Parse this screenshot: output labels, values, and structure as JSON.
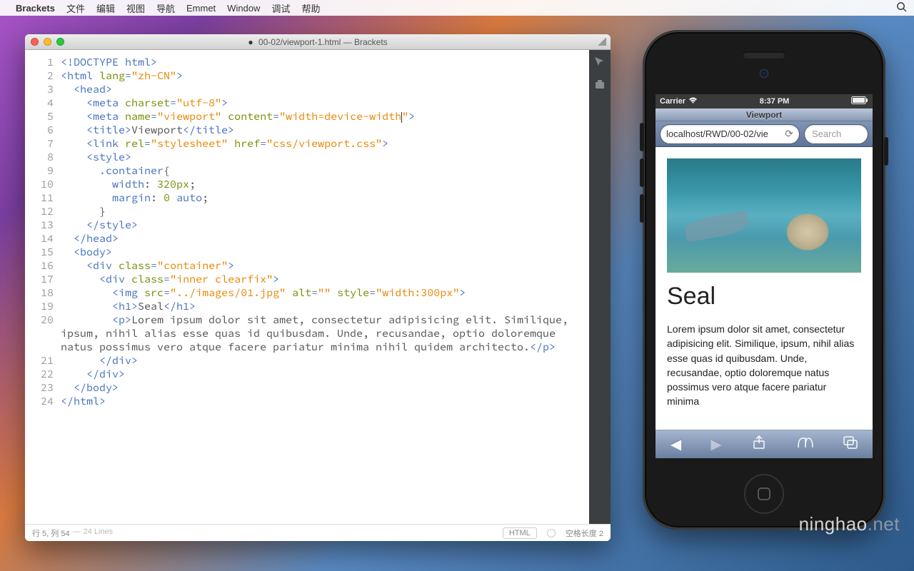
{
  "menubar": {
    "appname": "Brackets",
    "items": [
      "文件",
      "编辑",
      "视图",
      "导航",
      "Emmet",
      "Window",
      "调试",
      "帮助"
    ]
  },
  "window": {
    "title_prefix": "00-02/viewport-1.html",
    "title_suffix": "Brackets"
  },
  "code_lines": [
    [
      {
        "t": "tag",
        "v": "<!DOCTYPE html>"
      }
    ],
    [
      {
        "t": "tag",
        "v": "<html "
      },
      {
        "t": "attr",
        "v": "lang"
      },
      {
        "t": "tag",
        "v": "="
      },
      {
        "t": "str",
        "v": "\"zh-CN\""
      },
      {
        "t": "tag",
        "v": ">"
      }
    ],
    [
      {
        "t": "plain",
        "v": "  "
      },
      {
        "t": "tag",
        "v": "<head>"
      }
    ],
    [
      {
        "t": "plain",
        "v": "    "
      },
      {
        "t": "tag",
        "v": "<meta "
      },
      {
        "t": "attr",
        "v": "charset"
      },
      {
        "t": "tag",
        "v": "="
      },
      {
        "t": "str",
        "v": "\"utf-8\""
      },
      {
        "t": "tag",
        "v": ">"
      }
    ],
    [
      {
        "t": "plain",
        "v": "    "
      },
      {
        "t": "tag",
        "v": "<meta "
      },
      {
        "t": "attr",
        "v": "name"
      },
      {
        "t": "tag",
        "v": "="
      },
      {
        "t": "str",
        "v": "\"viewport\""
      },
      {
        "t": "plain",
        "v": " "
      },
      {
        "t": "attr",
        "v": "content"
      },
      {
        "t": "tag",
        "v": "="
      },
      {
        "t": "str",
        "v": "\"width=device-width"
      },
      {
        "t": "caret",
        "v": ""
      },
      {
        "t": "str",
        "v": "\""
      },
      {
        "t": "tag",
        "v": ">"
      }
    ],
    [
      {
        "t": "plain",
        "v": "    "
      },
      {
        "t": "tag",
        "v": "<title>"
      },
      {
        "t": "plain",
        "v": "Viewport"
      },
      {
        "t": "tag",
        "v": "</title>"
      }
    ],
    [
      {
        "t": "plain",
        "v": "    "
      },
      {
        "t": "tag",
        "v": "<link "
      },
      {
        "t": "attr",
        "v": "rel"
      },
      {
        "t": "tag",
        "v": "="
      },
      {
        "t": "str",
        "v": "\"stylesheet\""
      },
      {
        "t": "plain",
        "v": " "
      },
      {
        "t": "attr",
        "v": "href"
      },
      {
        "t": "tag",
        "v": "="
      },
      {
        "t": "str",
        "v": "\"css/viewport.css\""
      },
      {
        "t": "tag",
        "v": ">"
      }
    ],
    [
      {
        "t": "plain",
        "v": "    "
      },
      {
        "t": "tag",
        "v": "<style>"
      }
    ],
    [
      {
        "t": "plain",
        "v": "      "
      },
      {
        "t": "kw",
        "v": ".container"
      },
      {
        "t": "plain",
        "v": "{"
      }
    ],
    [
      {
        "t": "plain",
        "v": "        "
      },
      {
        "t": "kw",
        "v": "width"
      },
      {
        "t": "plain",
        "v": ": "
      },
      {
        "t": "num-lit",
        "v": "320px"
      },
      {
        "t": "plain",
        "v": ";"
      }
    ],
    [
      {
        "t": "plain",
        "v": "        "
      },
      {
        "t": "kw",
        "v": "margin"
      },
      {
        "t": "plain",
        "v": ": "
      },
      {
        "t": "num-lit",
        "v": "0"
      },
      {
        "t": "plain",
        "v": " "
      },
      {
        "t": "kw",
        "v": "auto"
      },
      {
        "t": "plain",
        "v": ";"
      }
    ],
    [
      {
        "t": "plain",
        "v": "      }"
      }
    ],
    [
      {
        "t": "plain",
        "v": "    "
      },
      {
        "t": "tag",
        "v": "</style>"
      }
    ],
    [
      {
        "t": "plain",
        "v": "  "
      },
      {
        "t": "tag",
        "v": "</head>"
      }
    ],
    [
      {
        "t": "plain",
        "v": "  "
      },
      {
        "t": "tag",
        "v": "<body>"
      }
    ],
    [
      {
        "t": "plain",
        "v": "    "
      },
      {
        "t": "tag",
        "v": "<div "
      },
      {
        "t": "attr",
        "v": "class"
      },
      {
        "t": "tag",
        "v": "="
      },
      {
        "t": "str",
        "v": "\"container\""
      },
      {
        "t": "tag",
        "v": ">"
      }
    ],
    [
      {
        "t": "plain",
        "v": "      "
      },
      {
        "t": "tag",
        "v": "<div "
      },
      {
        "t": "attr",
        "v": "class"
      },
      {
        "t": "tag",
        "v": "="
      },
      {
        "t": "str",
        "v": "\"inner clearfix\""
      },
      {
        "t": "tag",
        "v": ">"
      }
    ],
    [
      {
        "t": "plain",
        "v": "        "
      },
      {
        "t": "tag",
        "v": "<img "
      },
      {
        "t": "attr",
        "v": "src"
      },
      {
        "t": "tag",
        "v": "="
      },
      {
        "t": "str",
        "v": "\"../images/01.jpg\""
      },
      {
        "t": "plain",
        "v": " "
      },
      {
        "t": "attr",
        "v": "alt"
      },
      {
        "t": "tag",
        "v": "="
      },
      {
        "t": "str",
        "v": "\"\""
      },
      {
        "t": "plain",
        "v": " "
      },
      {
        "t": "attr",
        "v": "style"
      },
      {
        "t": "tag",
        "v": "="
      },
      {
        "t": "str",
        "v": "\"width:300px\""
      },
      {
        "t": "tag",
        "v": ">"
      }
    ],
    [
      {
        "t": "plain",
        "v": "        "
      },
      {
        "t": "tag",
        "v": "<h1>"
      },
      {
        "t": "plain",
        "v": "Seal"
      },
      {
        "t": "tag",
        "v": "</h1>"
      }
    ],
    [
      {
        "t": "plain",
        "v": "        "
      },
      {
        "t": "tag",
        "v": "<p>"
      },
      {
        "t": "plain",
        "v": "Lorem ipsum dolor sit amet, consectetur adipisicing elit. Similique, \nipsum, nihil alias esse quas id quibusdam. Unde, recusandae, optio doloremque \nnatus possimus vero atque facere pariatur minima nihil quidem architecto."
      },
      {
        "t": "tag",
        "v": "</p>"
      }
    ],
    [
      {
        "t": "plain",
        "v": "      "
      },
      {
        "t": "tag",
        "v": "</div>"
      }
    ],
    [
      {
        "t": "plain",
        "v": "    "
      },
      {
        "t": "tag",
        "v": "</div>"
      }
    ],
    [
      {
        "t": "plain",
        "v": "  "
      },
      {
        "t": "tag",
        "v": "</body>"
      }
    ],
    [
      {
        "t": "tag",
        "v": "</html>"
      }
    ]
  ],
  "statusbar": {
    "cursor": "行 5, 列 54",
    "lines": "24 Lines",
    "lang": "HTML",
    "indent": "空格长度  2"
  },
  "ios": {
    "carrier": "Carrier",
    "time": "8:37 PM",
    "title": "Viewport",
    "url": "localhost/RWD/00-02/vie",
    "search_placeholder": "Search",
    "heading": "Seal",
    "body": "Lorem ipsum dolor sit amet, consectetur adipisicing elit. Similique, ipsum, nihil alias esse quas id quibusdam. Unde, recusandae, optio doloremque natus possimus vero atque facere pariatur minima"
  },
  "watermark": {
    "main": "ninghao",
    "suffix": ".net"
  }
}
